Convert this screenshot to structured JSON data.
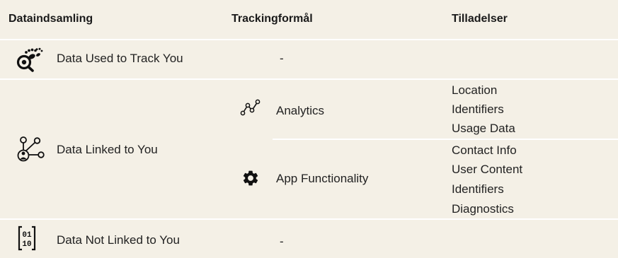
{
  "header": {
    "col1": "Dataindsamling",
    "col2": "Trackingformål",
    "col3": "Tilladelser"
  },
  "rows": [
    {
      "category": "Data Used to Track You",
      "icon": "track-footprint-icon",
      "purpose": "-"
    },
    {
      "category": "Data Linked to You",
      "icon": "linked-person-icon",
      "purposes": [
        {
          "name": "Analytics",
          "icon": "analytics-chart-icon",
          "permissions": [
            "Location",
            "Identifiers",
            "Usage Data"
          ]
        },
        {
          "name": "App Functionality",
          "icon": "gear-icon",
          "permissions": [
            "Contact Info",
            "User Content",
            "Identifiers",
            "Diagnostics"
          ]
        }
      ]
    },
    {
      "category": "Data Not Linked to You",
      "icon": "binary-data-icon",
      "purpose": "-"
    }
  ],
  "colors": {
    "background": "#f4f0e6",
    "separator": "#ffffff",
    "text": "#222222"
  }
}
